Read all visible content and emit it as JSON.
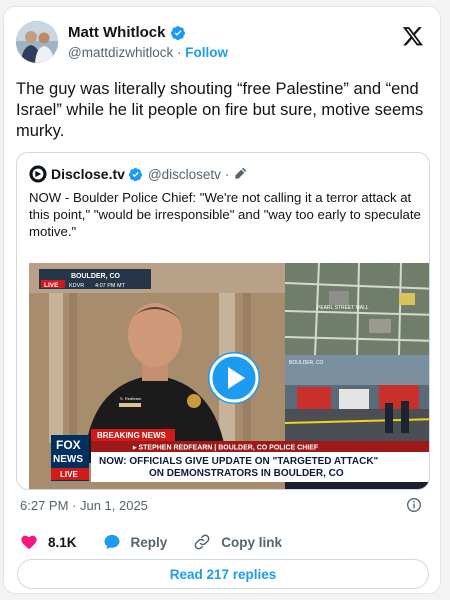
{
  "author": {
    "name": "Matt Whitlock",
    "handle": "@mattdizwhitlock",
    "separator": "·",
    "follow_label": "Follow"
  },
  "tweet": {
    "text": "The guy was literally shouting “free Palestine” and “end Israel” while he lit people on fire but sure, motive seems murky."
  },
  "quote": {
    "name": "Disclose.tv",
    "handle": "@disclosetv",
    "separator": "·",
    "text": "NOW - Boulder Police Chief: \"We're not calling it a terror attack at this point,\" \"would be irresponsible\" and \"way too early to speculate motive.\""
  },
  "video": {
    "location": "BOULDER, CO",
    "live_label": "LIVE",
    "station": "KDVR",
    "time": "4:07 PM MT",
    "map_label": "PEARL STREET MALL",
    "scene_label": "BOULDER, CO",
    "breaking_label": "BREAKING NEWS",
    "name_bar": "▸ STEPHEN REDFEARN | BOULDER, CO POLICE CHIEF",
    "headline_line1": "NOW: OFFICIALS GIVE UPDATE ON \"TARGETED ATTACK\"",
    "headline_line2": "ON DEMONSTRATORS IN BOULDER, CO",
    "logo_fox": "FOX",
    "logo_news": "NEWS",
    "logo_live": "LIVE",
    "nameplate": "S. Redfearn"
  },
  "timestamp": "6:27 PM · Jun 1, 2025",
  "actions": {
    "likes": "8.1K",
    "reply_label": "Reply",
    "copy_label": "Copy link"
  },
  "read_replies_label": "Read 217 replies",
  "colors": {
    "accent": "#1d9bf0",
    "like": "#f91880",
    "text": "#0f1419",
    "muted": "#536471",
    "border": "#cfd9de"
  },
  "icons": [
    "verified-badge-icon",
    "x-logo-icon",
    "disclose-logo-icon",
    "edit-pencil-icon",
    "play-icon",
    "info-icon",
    "heart-icon",
    "reply-bubble-icon",
    "link-icon"
  ]
}
